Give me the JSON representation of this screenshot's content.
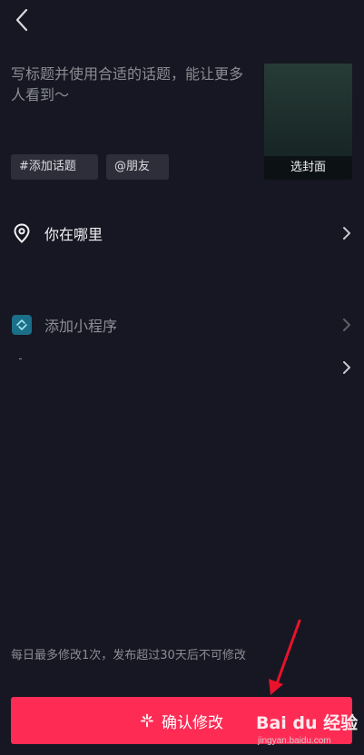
{
  "header": {
    "back_icon": "chevron-left-icon"
  },
  "caption": {
    "placeholder": "写标题并使用合适的话题，能让更多人看到～"
  },
  "cover": {
    "label": "选封面"
  },
  "chips": {
    "topic": "#添加话题",
    "friend": "@朋友"
  },
  "rows": {
    "location": {
      "label": "你在哪里",
      "icon": "location-pin-icon"
    },
    "miniapp": {
      "label": "添加小程序",
      "icon": "mini-program-icon"
    }
  },
  "footer": {
    "note": "每日最多修改1次，发布超过30天后不可修改",
    "confirm_label": "确认修改"
  },
  "watermark": {
    "brand": "Bai du 经验",
    "url": "jingyan.baidu.com"
  },
  "colors": {
    "accent": "#fe2c55",
    "background": "#161722",
    "chip": "#2d2e39"
  }
}
